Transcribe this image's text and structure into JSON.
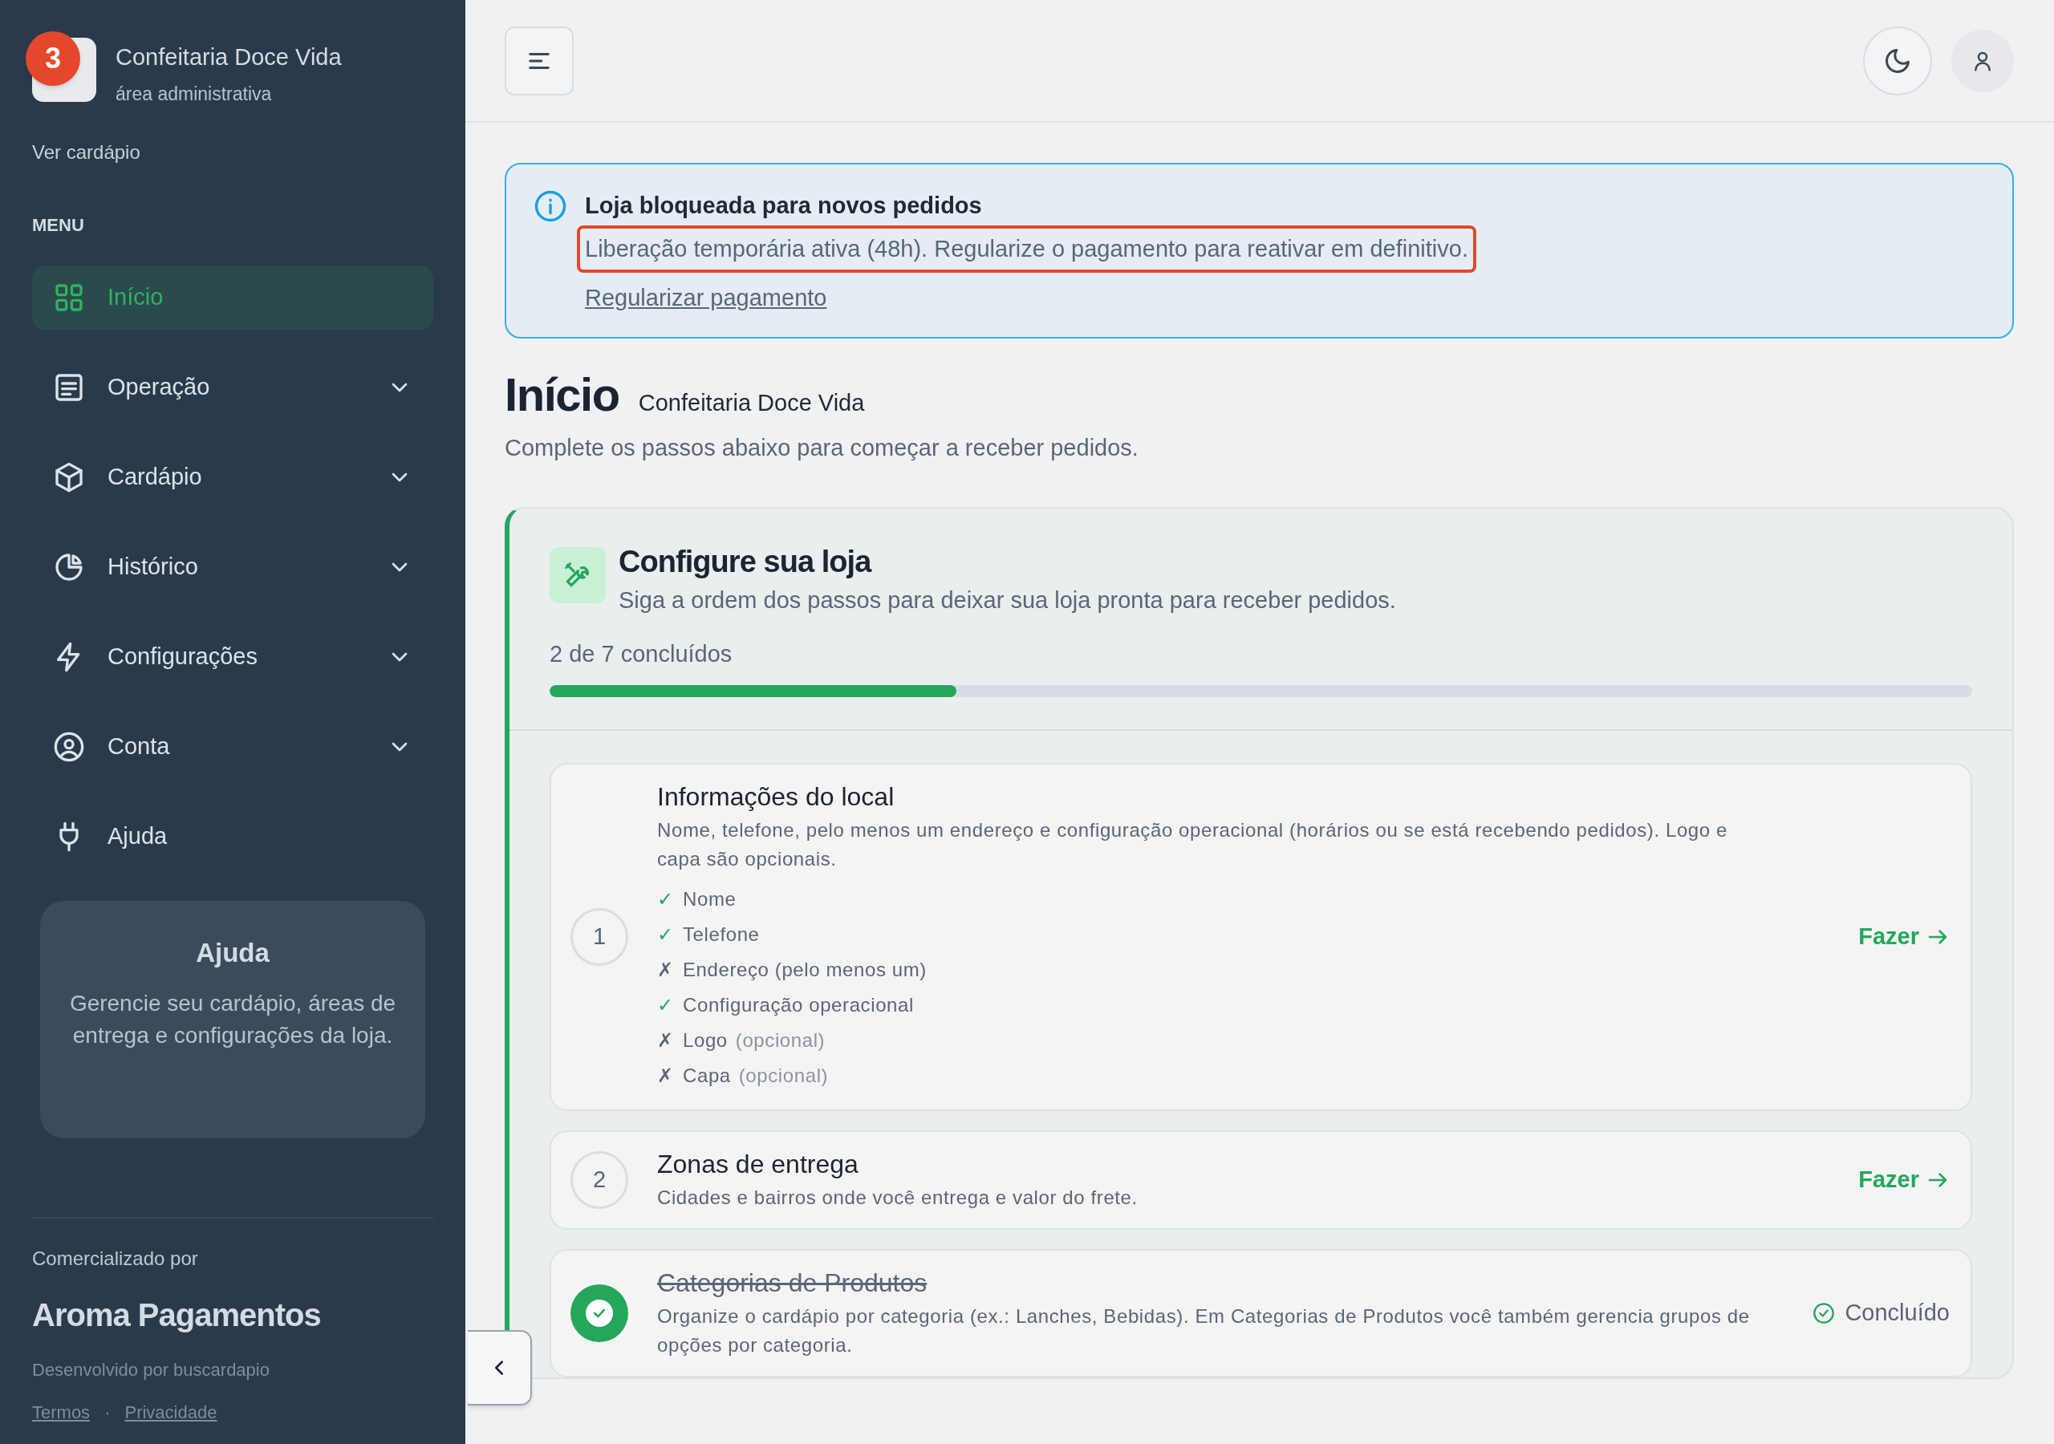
{
  "sidebar": {
    "annotation": "3",
    "brand": {
      "title": "Confeitaria Doce Vida",
      "subtitle": "área administrativa"
    },
    "link": "Ver cardápio",
    "section": "MENU",
    "items": [
      {
        "label": "Início",
        "kind": "grid",
        "selected": true,
        "expandable": false
      },
      {
        "label": "Operação",
        "kind": "list",
        "selected": false,
        "expandable": true
      },
      {
        "label": "Cardápio",
        "kind": "box",
        "selected": false,
        "expandable": true
      },
      {
        "label": "Histórico",
        "kind": "pie",
        "selected": false,
        "expandable": true
      },
      {
        "label": "Configurações",
        "kind": "bolt",
        "selected": false,
        "expandable": true
      },
      {
        "label": "Conta",
        "kind": "user",
        "selected": false,
        "expandable": true
      },
      {
        "label": "Ajuda",
        "kind": "plug",
        "selected": false,
        "expandable": false
      }
    ],
    "help_card": {
      "title": "Ajuda",
      "text": "Gerencie seu cardápio, áreas de entrega e configurações da loja."
    },
    "footer": {
      "label": "Comercializado por",
      "company": "Aroma Pagamentos",
      "credit": "Desenvolvido por buscardapio",
      "links": [
        "Termos",
        "Privacidade"
      ],
      "separator": "·"
    }
  },
  "alert": {
    "title": "Loja bloqueada para novos pedidos",
    "message": "Liberação temporária ativa (48h). Regularize o pagamento para reativar em definitivo.",
    "highlighted": true,
    "link": "Regularizar pagamento"
  },
  "page": {
    "title": "Início",
    "store": "Confeitaria Doce Vida",
    "subtitle": "Complete os passos abaixo para começar a receber pedidos."
  },
  "setup": {
    "title": "Configure sua loja",
    "subtitle": "Siga a ordem dos passos para deixar sua loja pronta para receber pedidos.",
    "progress_text": "2 de 7 concluídos",
    "level": 0.2857,
    "steps": [
      {
        "number": "1",
        "done": false,
        "title": "Informações do local",
        "description": "Nome, telefone, pelo menos um endereço e configuração operacional (horários ou se está recebendo pedidos). Logo e capa são opcionais.",
        "action": "Fazer",
        "checklist": [
          {
            "mark": "✓",
            "label": "Nome",
            "done": true
          },
          {
            "mark": "✓",
            "label": "Telefone",
            "done": true
          },
          {
            "mark": "✗",
            "label": "Endereço (pelo menos um)",
            "done": false
          },
          {
            "mark": "✓",
            "label": "Configuração operacional",
            "done": true
          },
          {
            "mark": "✗",
            "label": "Logo",
            "note": "(opcional)",
            "done": false
          },
          {
            "mark": "✗",
            "label": "Capa",
            "note": "(opcional)",
            "done": false
          }
        ]
      },
      {
        "number": "2",
        "done": false,
        "title": "Zonas de entrega",
        "description": "Cidades e bairros onde você entrega e valor do frete.",
        "action": "Fazer"
      },
      {
        "done": true,
        "title": "Categorias de Produtos",
        "description": "Organize o cardápio por categoria (ex.: Lanches, Bebidas). Em Categorias de Produtos você também gerencia grupos de opções por categoria.",
        "action": "Concluído"
      }
    ]
  }
}
